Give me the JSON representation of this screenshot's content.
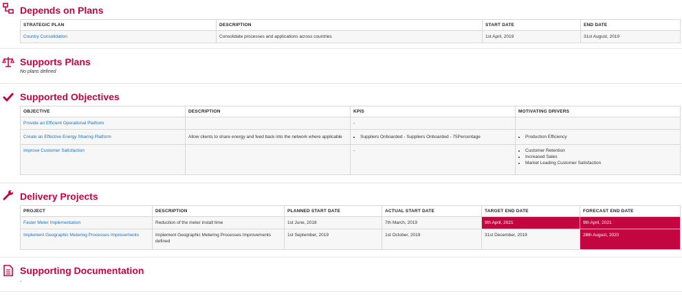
{
  "depends": {
    "title": "Depends on Plans",
    "headers": [
      "STRATEGIC PLAN",
      "DESCRIPTION",
      "START DATE",
      "END DATE"
    ],
    "rows": [
      {
        "plan": "Country Consolidation",
        "description": "Consolidate processes and applications across countries",
        "start": "1st April, 2019",
        "end": "31st August, 2019"
      }
    ]
  },
  "supports": {
    "title": "Supports Plans",
    "empty": "No plans defined"
  },
  "objectives": {
    "title": "Supported Objectives",
    "headers": [
      "OBJECTIVE",
      "DESCRIPTION",
      "KPIS",
      "MOTIVATING DRIVERS"
    ],
    "rows": [
      {
        "objective": "Provide an Efficient Operational Platform",
        "description": "",
        "kpis_text": "-",
        "drivers": []
      },
      {
        "objective": "Create an Effective Energy Sharing Platform",
        "description": "Allow clients to share energy and feed back into the network where applicable",
        "kpis": [
          "Suppliers Onboarded - Suppliers Onboarded - 75Percentage"
        ],
        "drivers": [
          "Production Efficiency"
        ]
      },
      {
        "objective": "Improve Customer Satisfaction",
        "description": "",
        "kpis_text": "-",
        "drivers": [
          "Customer Retention",
          "Increased Sales",
          "Market Leading Customer Satisfaction"
        ]
      }
    ]
  },
  "projects": {
    "title": "Delivery Projects",
    "headers": [
      "PROJECT",
      "DESCRIPTION",
      "PLANNED START DATE",
      "ACTUAL START DATE",
      "TARGET END DATE",
      "FORECAST END DATE"
    ],
    "rows": [
      {
        "project": "Faster Meter Implementation",
        "description": "Reduction of the meter install time",
        "planned": "1st June, 2018",
        "actual": "7th March, 2019",
        "target": "9th April, 2021",
        "forecast": "9th April, 2021"
      },
      {
        "project": "Implement Geographic Metering Processes Improvements",
        "description": "Implement Geographic Metering Processes Improvements defined",
        "planned": "1st September, 2019",
        "actual": "1st October, 2019",
        "target": "31st December, 2019",
        "forecast": "28th August, 2020"
      }
    ]
  },
  "documentation": {
    "title": "Supporting Documentation",
    "empty": "-"
  },
  "colors": {
    "accent": "#c3063f",
    "link": "#1a73c7"
  }
}
